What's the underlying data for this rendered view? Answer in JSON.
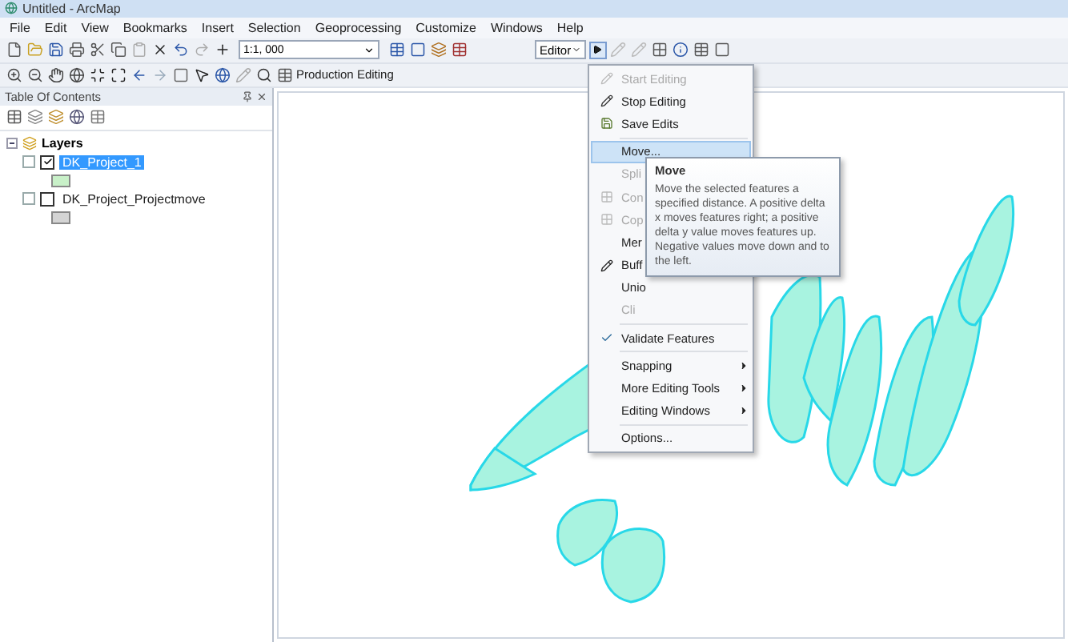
{
  "window": {
    "title": "Untitled - ArcMap"
  },
  "menu_bar": [
    "File",
    "Edit",
    "View",
    "Bookmarks",
    "Insert",
    "Selection",
    "Geoprocessing",
    "Customize",
    "Windows",
    "Help"
  ],
  "toolbar": {
    "scale": "1:1, 000",
    "production_label": "Production Editing",
    "editor_label": "Editor"
  },
  "toc": {
    "title": "Table Of Contents",
    "root": {
      "label": "Layers",
      "expanded": true,
      "children": [
        {
          "label": "DK_Project_1",
          "checked": true,
          "selected": true,
          "color": "#c8f0c8"
        },
        {
          "label": "DK_Project_Projectmove",
          "checked": false,
          "selected": false,
          "color": "#d4d4d4"
        }
      ]
    }
  },
  "editor_menu": {
    "groups": [
      [
        {
          "label": "Start Editing",
          "kind": "pencil",
          "disabled": true,
          "highlighted": false,
          "submenu": false
        },
        {
          "label": "Stop Editing",
          "kind": "pencil",
          "disabled": false,
          "highlighted": false,
          "submenu": false
        },
        {
          "label": "Save Edits",
          "kind": "save",
          "disabled": false,
          "highlighted": false,
          "submenu": false
        }
      ],
      [
        {
          "label": "Move...",
          "kind": "plain",
          "disabled": false,
          "highlighted": true,
          "submenu": false
        },
        {
          "label": "Spli",
          "kind": "plain",
          "disabled": true,
          "highlighted": false
        },
        {
          "label": "Con",
          "kind": "grid",
          "disabled": true,
          "highlighted": false
        },
        {
          "label": "Cop",
          "kind": "grid",
          "disabled": true,
          "highlighted": false
        },
        {
          "label": "Mer",
          "kind": "plain",
          "disabled": false,
          "highlighted": false
        },
        {
          "label": "Buff",
          "kind": "pen",
          "disabled": false,
          "highlighted": false
        },
        {
          "label": "Unio",
          "kind": "plain",
          "disabled": false,
          "highlighted": false
        },
        {
          "label": "Cli",
          "kind": "plain",
          "disabled": true,
          "highlighted": false
        }
      ],
      [
        {
          "label": "Validate Features",
          "kind": "validate",
          "disabled": false,
          "highlighted": false,
          "submenu": false
        }
      ],
      [
        {
          "label": "Snapping",
          "kind": "plain",
          "disabled": false,
          "highlighted": false,
          "submenu": true
        },
        {
          "label": "More Editing Tools",
          "kind": "plain",
          "disabled": false,
          "highlighted": false,
          "submenu": true
        },
        {
          "label": "Editing Windows",
          "kind": "plain",
          "disabled": false,
          "highlighted": false,
          "submenu": true
        }
      ],
      [
        {
          "label": "Options...",
          "kind": "plain",
          "disabled": false,
          "highlighted": false,
          "submenu": false
        }
      ]
    ]
  },
  "tooltip": {
    "title": "Move",
    "text": "Move the selected features a specified distance. A positive delta x moves features right; a positive delta y value moves features up. Negative values move down and to the left."
  }
}
